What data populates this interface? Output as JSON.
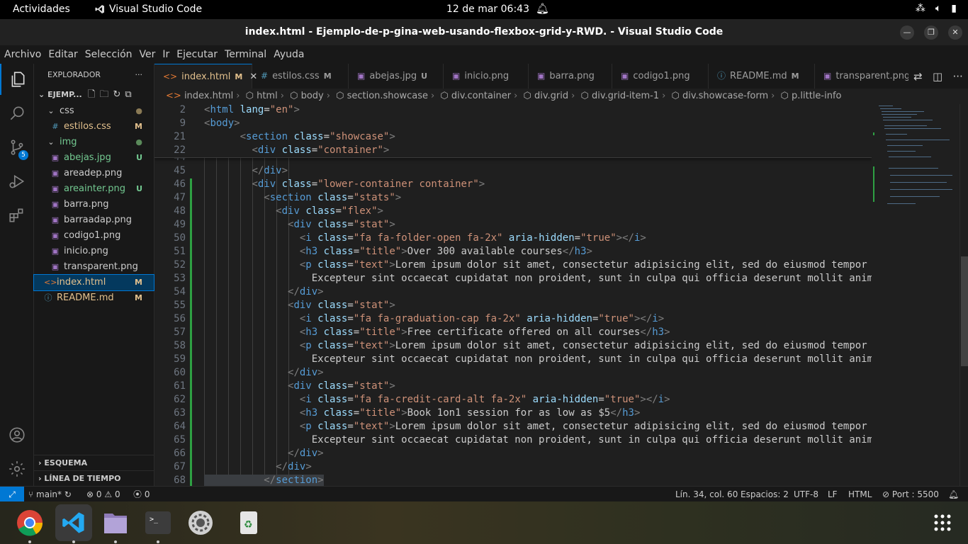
{
  "system": {
    "activities": "Actividades",
    "app_name": "Visual Studio Code",
    "clock": "12 de mar  06:43"
  },
  "window": {
    "title": "index.html - Ejemplo-de-p-gina-web-usando-flexbox-grid-y-RWD. - Visual Studio Code"
  },
  "menu": [
    "Archivo",
    "Editar",
    "Selección",
    "Ver",
    "Ir",
    "Ejecutar",
    "Terminal",
    "Ayuda"
  ],
  "activity_bar": {
    "scm_badge": "5"
  },
  "sidebar": {
    "header": "EXPLORADOR",
    "more": "···",
    "project": "EJEMP...",
    "tree": [
      {
        "label": "css",
        "status": "●",
        "kind": "folder"
      },
      {
        "label": "estilos.css",
        "status": "M",
        "kind": "css"
      },
      {
        "label": "img",
        "status": "●",
        "kind": "folder"
      },
      {
        "label": "abejas.jpg",
        "status": "U",
        "kind": "img"
      },
      {
        "label": "areadep.png",
        "status": "",
        "kind": "img"
      },
      {
        "label": "areainter.png",
        "status": "U",
        "kind": "img"
      },
      {
        "label": "barra.png",
        "status": "",
        "kind": "img"
      },
      {
        "label": "barraadap.png",
        "status": "",
        "kind": "img"
      },
      {
        "label": "codigo1.png",
        "status": "",
        "kind": "img"
      },
      {
        "label": "inicio.png",
        "status": "",
        "kind": "img"
      },
      {
        "label": "transparent.png",
        "status": "",
        "kind": "img"
      },
      {
        "label": "index.html",
        "status": "M",
        "kind": "html"
      },
      {
        "label": "README.md",
        "status": "M",
        "kind": "info"
      }
    ],
    "outline": "ESQUEMA",
    "timeline": "LÍNEA DE TIEMPO"
  },
  "tabs": [
    {
      "label": "index.html",
      "status": "M",
      "icon": "html"
    },
    {
      "label": "estilos.css",
      "status": "M",
      "icon": "css"
    },
    {
      "label": "abejas.jpg",
      "status": "U",
      "icon": "img"
    },
    {
      "label": "inicio.png",
      "status": "",
      "icon": "img"
    },
    {
      "label": "barra.png",
      "status": "",
      "icon": "img"
    },
    {
      "label": "codigo1.png",
      "status": "",
      "icon": "img"
    },
    {
      "label": "README.md",
      "status": "M",
      "icon": "info"
    },
    {
      "label": "transparent.png",
      "status": "",
      "icon": "img"
    }
  ],
  "breadcrumbs": [
    "index.html",
    "html",
    "body",
    "section.showcase",
    "div.container",
    "div.grid",
    "div.grid-item-1",
    "div.showcase-form",
    "p.little-info"
  ],
  "sticky_lines": [
    {
      "n": "2",
      "code": "<html lang=\"en\">"
    },
    {
      "n": "9",
      "code": "<body>"
    },
    {
      "n": "21",
      "code": "      <section class=\"showcase\">"
    },
    {
      "n": "22",
      "code": "        <div class=\"container\">"
    }
  ],
  "code_lines": [
    {
      "n": "44",
      "code": ""
    },
    {
      "n": "45",
      "code": "        </div>"
    },
    {
      "n": "46",
      "code": "        <div class=\"lower-container container\">"
    },
    {
      "n": "47",
      "code": "          <section class=\"stats\">"
    },
    {
      "n": "48",
      "code": "            <div class=\"flex\">"
    },
    {
      "n": "49",
      "code": "              <div class=\"stat\">"
    },
    {
      "n": "50",
      "code": "                <i class=\"fa fa-folder-open fa-2x\" aria-hidden=\"true\"></i>"
    },
    {
      "n": "51",
      "code": "                <h3 class=\"title\">Over 300 available courses</h3>"
    },
    {
      "n": "52",
      "code": "                <p class=\"text\">Lorem ipsum dolor sit amet, consectetur adipisicing elit, sed do eiusmod tempor"
    },
    {
      "n": "53",
      "code": "                  Excepteur sint occaecat cupidatat non proident, sunt in culpa qui officia deserunt mollit anim"
    },
    {
      "n": "54",
      "code": "              </div>"
    },
    {
      "n": "55",
      "code": "              <div class=\"stat\">"
    },
    {
      "n": "56",
      "code": "                <i class=\"fa fa-graduation-cap fa-2x\" aria-hidden=\"true\"></i>"
    },
    {
      "n": "57",
      "code": "                <h3 class=\"title\">Free certificate offered on all courses</h3>"
    },
    {
      "n": "58",
      "code": "                <p class=\"text\">Lorem ipsum dolor sit amet, consectetur adipisicing elit, sed do eiusmod tempor"
    },
    {
      "n": "59",
      "code": "                  Excepteur sint occaecat cupidatat non proident, sunt in culpa qui officia deserunt mollit anim"
    },
    {
      "n": "60",
      "code": "              </div>"
    },
    {
      "n": "61",
      "code": "              <div class=\"stat\">"
    },
    {
      "n": "62",
      "code": "                <i class=\"fa fa-credit-card-alt fa-2x\" aria-hidden=\"true\"></i>"
    },
    {
      "n": "63",
      "code": "                <h3 class=\"title\">Book 1on1 session for as low as $5</h3>"
    },
    {
      "n": "64",
      "code": "                <p class=\"text\">Lorem ipsum dolor sit amet, consectetur adipisicing elit, sed do eiusmod tempor"
    },
    {
      "n": "65",
      "code": "                  Excepteur sint occaecat cupidatat non proident, sunt in culpa qui officia deserunt mollit anim"
    },
    {
      "n": "66",
      "code": "              </div>"
    },
    {
      "n": "67",
      "code": "            </div>"
    },
    {
      "n": "68",
      "code": "          </section>"
    }
  ],
  "status": {
    "branch": "main*",
    "errors": "0",
    "warnings": "0",
    "ports": "0",
    "position": "Lín. 34, col. 60",
    "spaces": "Espacios: 2",
    "encoding": "UTF-8",
    "eol": "LF",
    "language": "HTML",
    "live_server": "Port : 5500"
  },
  "colors": {
    "accent": "#0078d4",
    "modified": "#e2c08d",
    "untracked": "#73c991",
    "tag": "#569cd6",
    "attr": "#9cdcfe",
    "string": "#ce9178"
  }
}
